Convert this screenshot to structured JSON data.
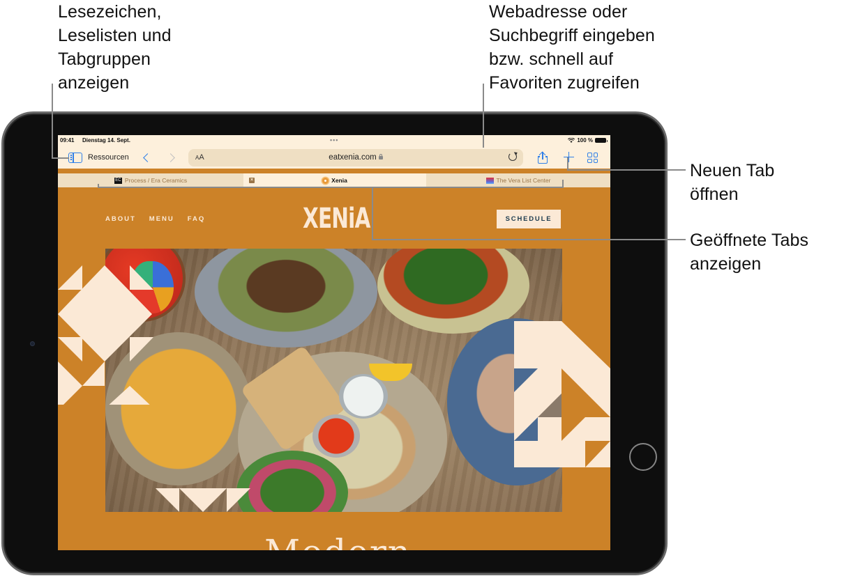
{
  "callouts": {
    "sidebar": "Lesezeichen,\nLeselisten und\nTabgruppen\nanzeigen",
    "address": "Webadresse oder\nSuchbegriff eingeben\nbzw. schnell auf\nFavoriten zugreifen",
    "new_tab": "Neuen Tab\nöffnen",
    "open_tabs": "Geöffnete Tabs\nanzeigen"
  },
  "status_bar": {
    "time": "09:41",
    "date": "Dienstag 14. Sept.",
    "battery": "100 %",
    "multitask_dots": "•••"
  },
  "toolbar": {
    "tab_group_label": "Ressourcen",
    "text_size_label_small": "A",
    "text_size_label_large": "A",
    "url": "eatxenia.com",
    "accent_color": "#2f7fe8"
  },
  "tabs": [
    {
      "title": "Process / Era Ceramics",
      "favicon": "EC",
      "active": false
    },
    {
      "title": "Xenia",
      "active": true,
      "close_glyph": "×"
    },
    {
      "title": "The Vera List Center",
      "active": false
    }
  ],
  "website": {
    "nav": [
      "ABOUT",
      "MENU",
      "FAQ"
    ],
    "logo": "XENiA",
    "schedule_button": "SCHEDULE",
    "heading_partial": "Modern",
    "brand_color": "#cc8228",
    "cream_color": "#fbe9d6"
  }
}
